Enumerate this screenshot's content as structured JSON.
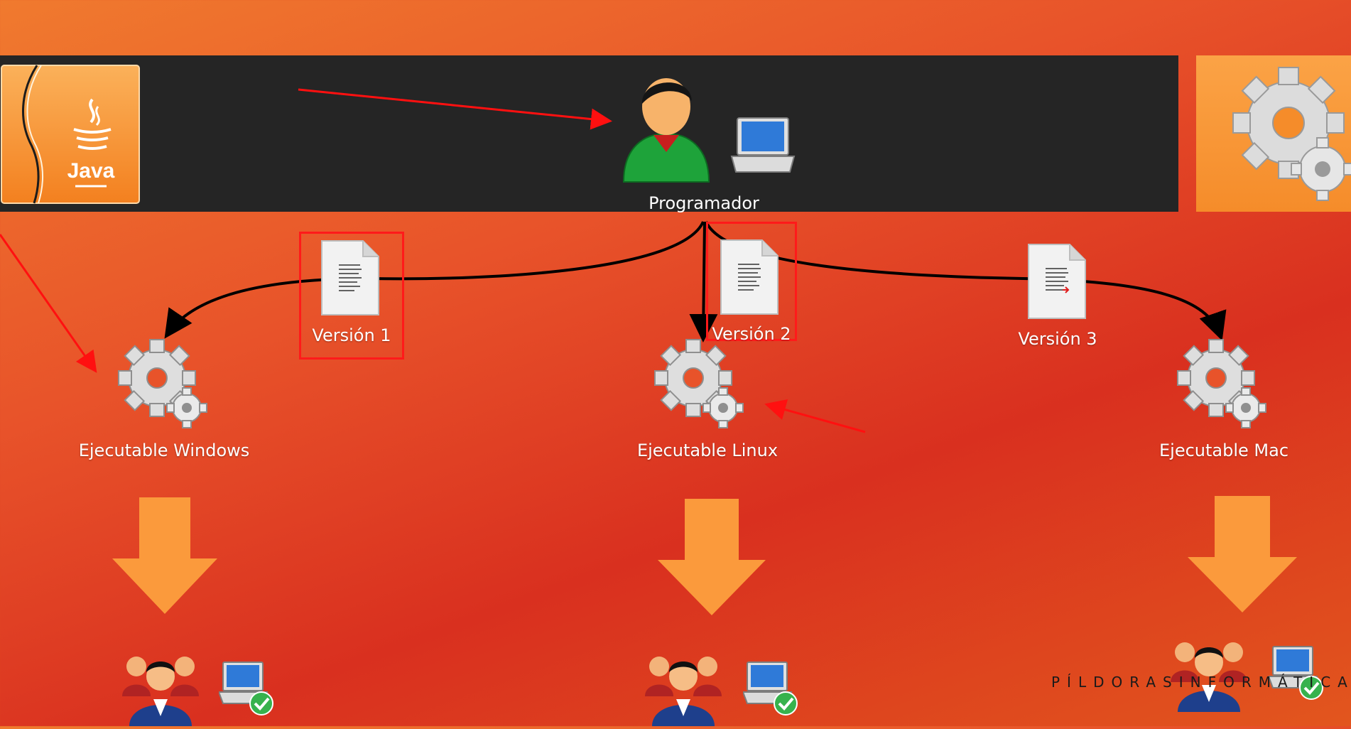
{
  "programmer_label": "Programador",
  "java_logo_text": "Java",
  "versions": [
    {
      "label": "Versión 1"
    },
    {
      "label": "Versión 2"
    },
    {
      "label": "Versión 3"
    }
  ],
  "executables": [
    {
      "label": "Ejecutable Windows"
    },
    {
      "label": "Ejecutable Linux"
    },
    {
      "label": "Ejecutable Mac"
    }
  ],
  "watermark": "PÍLDORASINFORMÁTICAS",
  "colors": {
    "background": "#e8532a",
    "topbar": "#252525",
    "highlight": "#ff1a1a",
    "arrow_down": "#fb9a3c",
    "gear": "#d6d6d6"
  },
  "icons": [
    "java-logo-icon",
    "programmer-icon",
    "laptop-icon",
    "document-icon",
    "gear-icon",
    "down-arrow-icon",
    "users-group-icon",
    "laptop-check-icon"
  ]
}
